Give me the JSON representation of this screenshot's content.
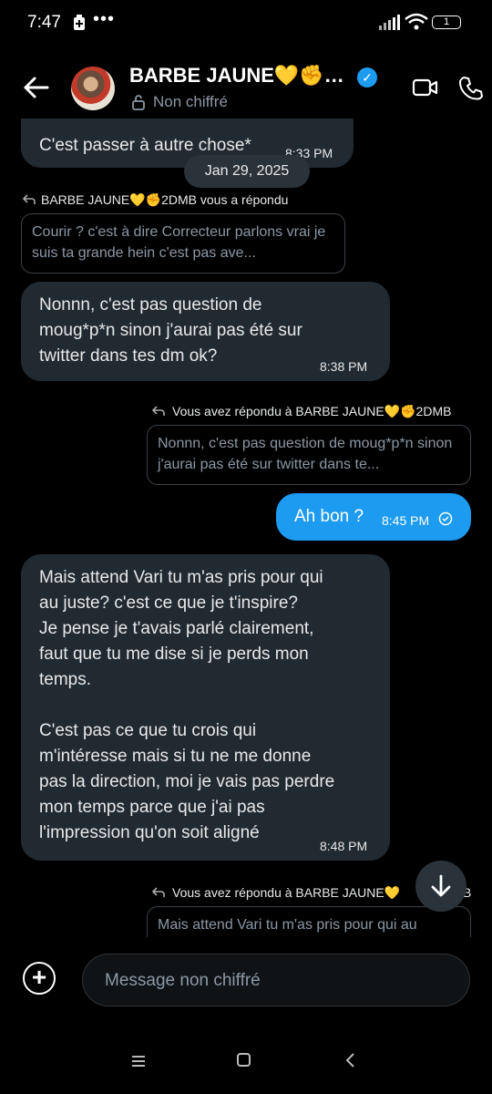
{
  "status_bar": {
    "time": "7:47",
    "battery": "1"
  },
  "header": {
    "name": "BARBE JAUNE💛✊…",
    "subtitle": "Non chiffré"
  },
  "messages": {
    "top_partial": {
      "text": "C'est passer à autre chose*",
      "time": "8:33 PM"
    },
    "date": "Jan 29, 2025",
    "reply1": {
      "label": "BARBE JAUNE💛✊2DMB vous a répondu",
      "quote": "Courir ? c'est à dire Correcteur parlons vrai je suis ta grande hein c'est pas ave..."
    },
    "msg1": {
      "lines": [
        "Nonnn, c'est pas question de",
        "moug*p*n sinon j'aurai pas été sur",
        "twitter dans tes dm ok?"
      ],
      "time": "8:38 PM"
    },
    "reply2": {
      "label": "Vous avez répondu à BARBE JAUNE💛✊2DMB",
      "quote": "Nonnn, c'est pas question de moug*p*n sinon j'aurai pas été sur twitter dans te..."
    },
    "msg2": {
      "text": "Ah bon ?",
      "time": "8:45 PM"
    },
    "msg3": {
      "lines": [
        "Mais attend Vari tu m'as pris pour qui",
        "au juste? c'est ce que je t'inspire?",
        "Je pense je t'avais parlé clairement,",
        "faut que tu me dise si je perds mon",
        "temps.",
        "",
        "C'est pas ce que tu crois qui",
        "m'intéresse mais si tu ne me donne",
        "pas la direction, moi je vais pas perdre",
        "mon temps parce que j'ai pas",
        "l'impression qu'on soit aligné"
      ],
      "time": "8:48 PM"
    },
    "reply3": {
      "label": "Vous avez répondu à BARBE JAUNE💛",
      "label_tail": "B",
      "quote": "Mais attend Vari tu m'as pris pour qui au"
    }
  },
  "composer": {
    "placeholder": "Message non chiffré"
  }
}
